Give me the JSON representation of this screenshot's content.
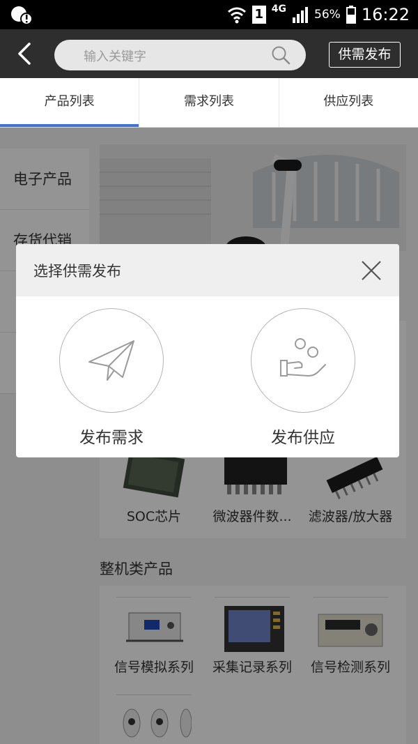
{
  "status_bar": {
    "sim": "1",
    "network": "4G",
    "battery": "56%",
    "time": "16:22"
  },
  "header": {
    "search_placeholder": "输入关键字",
    "publish_label": "供需发布"
  },
  "tabs": [
    {
      "label": "产品列表",
      "active": true
    },
    {
      "label": "需求列表",
      "active": false
    },
    {
      "label": "供应列表",
      "active": false
    }
  ],
  "categories": [
    {
      "label": "电子产品"
    },
    {
      "label": "存货代销"
    }
  ],
  "panel1_items": [
    {
      "label": "SOC芯片"
    },
    {
      "label": "微波器件数..."
    },
    {
      "label": "滤波器/放大器"
    }
  ],
  "section2": {
    "title": "整机类产品",
    "items": [
      {
        "label": "信号模拟系列"
      },
      {
        "label": "采集记录系列"
      },
      {
        "label": "信号检测系列"
      }
    ]
  },
  "modal": {
    "title": "选择供需发布",
    "options": [
      {
        "label": "发布需求",
        "icon": "paper-plane-icon"
      },
      {
        "label": "发布供应",
        "icon": "hand-coins-icon"
      }
    ]
  }
}
